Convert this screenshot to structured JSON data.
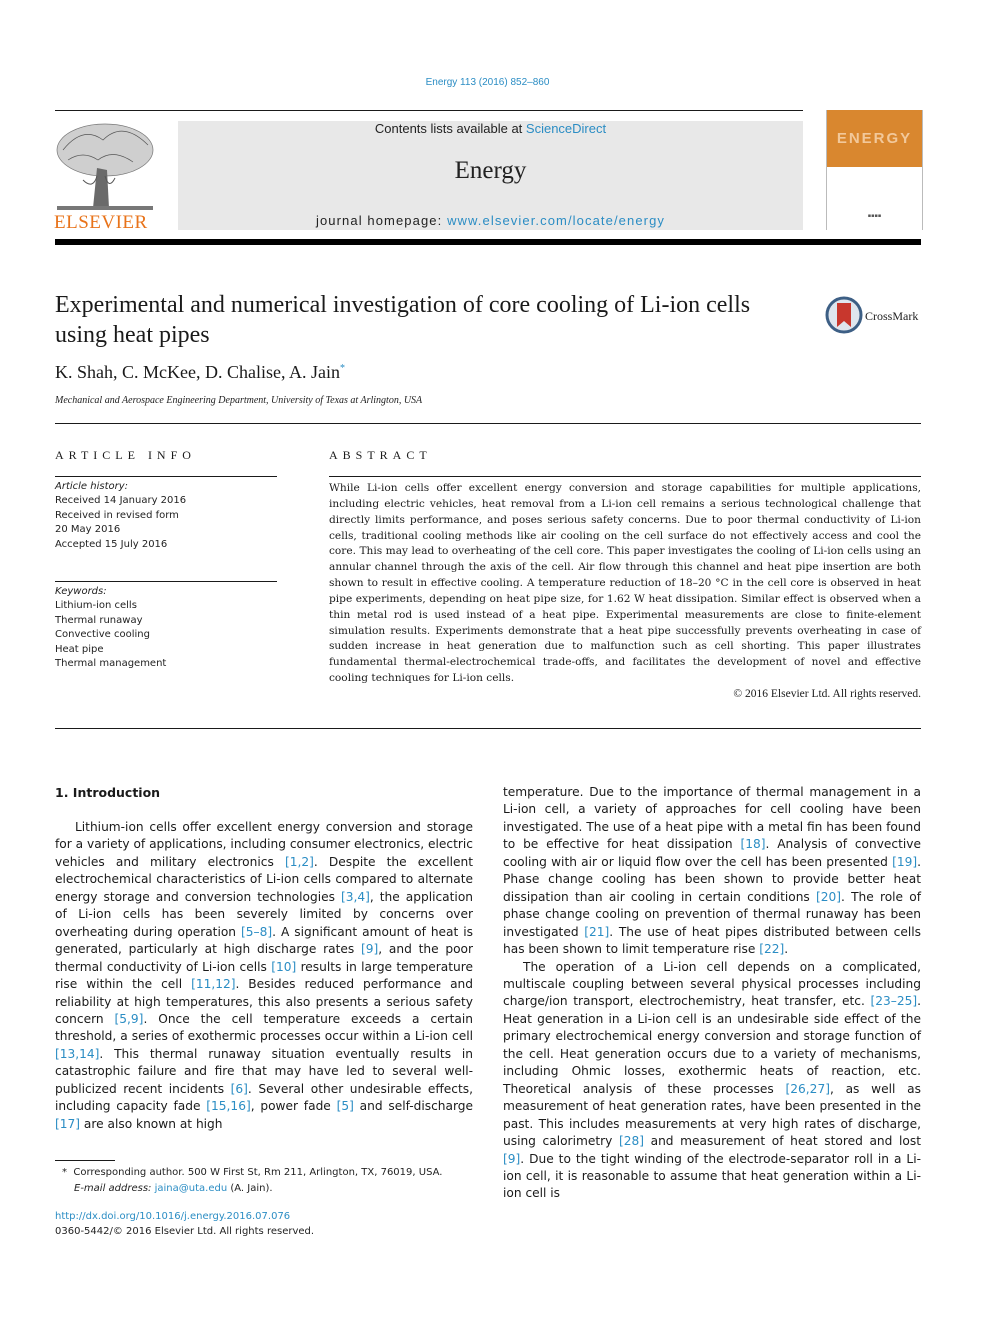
{
  "journal_ref": "Energy 113 (2016) 852–860",
  "masthead": {
    "contents_prefix": "Contents lists available at ",
    "contents_link": "ScienceDirect",
    "journal_name": "Energy",
    "homepage_prefix": "journal homepage: ",
    "homepage_link": "www.elsevier.com/locate/energy",
    "publisher_wordmark": "ELSEVIER",
    "cover_title": "ENERGY",
    "colors": {
      "publisher_orange": "#e8731a",
      "link_blue": "#2b8dc4",
      "cover_orange": "#d9872f"
    }
  },
  "article": {
    "title": "Experimental and numerical investigation of core cooling of Li-ion cells using heat pipes",
    "crossmark_label": "CrossMark",
    "authors": "K. Shah, C. McKee, D. Chalise, A. Jain",
    "corresponding_marker": "*",
    "affiliation": "Mechanical and Aerospace Engineering Department, University of Texas at Arlington, USA"
  },
  "article_info": {
    "heading": "ARTICLE INFO",
    "history_label": "Article history:",
    "history": [
      "Received 14 January 2016",
      "Received in revised form",
      "20 May 2016",
      "Accepted 15 July 2016"
    ],
    "keywords_label": "Keywords:",
    "keywords": [
      "Lithium-ion cells",
      "Thermal runaway",
      "Convective cooling",
      "Heat pipe",
      "Thermal management"
    ]
  },
  "abstract": {
    "heading": "ABSTRACT",
    "text": "While Li-ion cells offer excellent energy conversion and storage capabilities for multiple applications, including electric vehicles, heat removal from a Li-ion cell remains a serious technological challenge that directly limits performance, and poses serious safety concerns. Due to poor thermal conductivity of Li-ion cells, traditional cooling methods like air cooling on the cell surface do not effectively access and cool the core. This may lead to overheating of the cell core. This paper investigates the cooling of Li-ion cells using an annular channel through the axis of the cell. Air flow through this channel and heat pipe insertion are both shown to result in effective cooling. A temperature reduction of 18–20 °C in the cell core is observed in heat pipe experiments, depending on heat pipe size, for 1.62 W heat dissipation. Similar effect is observed when a thin metal rod is used instead of a heat pipe. Experimental measurements are close to finite-element simulation results. Experiments demonstrate that a heat pipe successfully prevents overheating in case of sudden increase in heat generation due to malfunction such as cell shorting. This paper illustrates fundamental thermal-electrochemical trade-offs, and facilitates the development of novel and effective cooling techniques for Li-ion cells.",
    "copyright": "© 2016 Elsevier Ltd. All rights reserved."
  },
  "introduction": {
    "heading": "1.  Introduction",
    "left_paragraph": [
      {
        "t": "Lithium-ion cells offer excellent energy conversion and storage for a variety of applications, including consumer electronics, electric vehicles and military electronics "
      },
      {
        "c": "[1,2]"
      },
      {
        "t": ". Despite the excellent electrochemical characteristics of Li-ion cells compared to alternate energy storage and conversion technologies "
      },
      {
        "c": "[3,4]"
      },
      {
        "t": ", the application of Li-ion cells has been severely limited by concerns over overheating during operation "
      },
      {
        "c": "[5–8]"
      },
      {
        "t": ". A significant amount of heat is generated, particularly at high discharge rates "
      },
      {
        "c": "[9]"
      },
      {
        "t": ", and the poor thermal conductivity of Li-ion cells "
      },
      {
        "c": "[10]"
      },
      {
        "t": " results in large temperature rise within the cell "
      },
      {
        "c": "[11,12]"
      },
      {
        "t": ". Besides reduced performance and reliability at high temperatures, this also presents a serious safety concern "
      },
      {
        "c": "[5,9]"
      },
      {
        "t": ". Once the cell temperature exceeds a certain threshold, a series of exothermic processes occur within a Li-ion cell "
      },
      {
        "c": "[13,14]"
      },
      {
        "t": ". This thermal runaway situation eventually results in catastrophic failure and fire that may have led to several well-publicized recent incidents "
      },
      {
        "c": "[6]"
      },
      {
        "t": ". Several other undesirable effects, including capacity fade "
      },
      {
        "c": "[15,16]"
      },
      {
        "t": ", power fade "
      },
      {
        "c": "[5]"
      },
      {
        "t": " and self-discharge "
      },
      {
        "c": "[17]"
      },
      {
        "t": " are also known at high"
      }
    ],
    "right_paragraph_1": [
      {
        "t": "temperature. Due to the importance of thermal management in a Li-ion cell, a variety of approaches for cell cooling have been investigated. The use of a heat pipe with a metal fin has been found to be effective for heat dissipation "
      },
      {
        "c": "[18]"
      },
      {
        "t": ". Analysis of convective cooling with air or liquid flow over the cell has been presented "
      },
      {
        "c": "[19]"
      },
      {
        "t": ". Phase change cooling has been shown to provide better heat dissipation than air cooling in certain conditions "
      },
      {
        "c": "[20]"
      },
      {
        "t": ". The role of phase change cooling on prevention of thermal runaway has been investigated "
      },
      {
        "c": "[21]"
      },
      {
        "t": ". The use of heat pipes distributed between cells has been shown to limit temperature rise "
      },
      {
        "c": "[22]"
      },
      {
        "t": "."
      }
    ],
    "right_paragraph_2": [
      {
        "t": "The operation of a Li-ion cell depends on a complicated, multiscale coupling between several physical processes including charge/ion transport, electrochemistry, heat transfer, etc. "
      },
      {
        "c": "[23–25]"
      },
      {
        "t": ". Heat generation in a Li-ion cell is an undesirable side effect of the primary electrochemical energy conversion and storage function of the cell. Heat generation occurs due to a variety of mechanisms, including Ohmic losses, exothermic heats of reaction, etc. Theoretical analysis of these processes "
      },
      {
        "c": "[26,27]"
      },
      {
        "t": ", as well as measurement of heat generation rates, have been presented in the past. This includes measurements at very high rates of discharge, using calorimetry "
      },
      {
        "c": "[28]"
      },
      {
        "t": " and measurement of heat stored and lost "
      },
      {
        "c": "[9]"
      },
      {
        "t": ". Due to the tight winding of the electrode-separator roll in a Li-ion cell, it is reasonable to assume that heat generation within a Li-ion cell is"
      }
    ]
  },
  "footnote": {
    "marker": "*",
    "text": "Corresponding author. 500 W First St, Rm 211, Arlington, TX, 76019, USA.",
    "email_label": "E-mail address:",
    "email": "jaina@uta.edu",
    "email_suffix": " (A. Jain)."
  },
  "doi": "http://dx.doi.org/10.1016/j.energy.2016.07.076",
  "issn_line": "0360-5442/© 2016 Elsevier Ltd. All rights reserved."
}
